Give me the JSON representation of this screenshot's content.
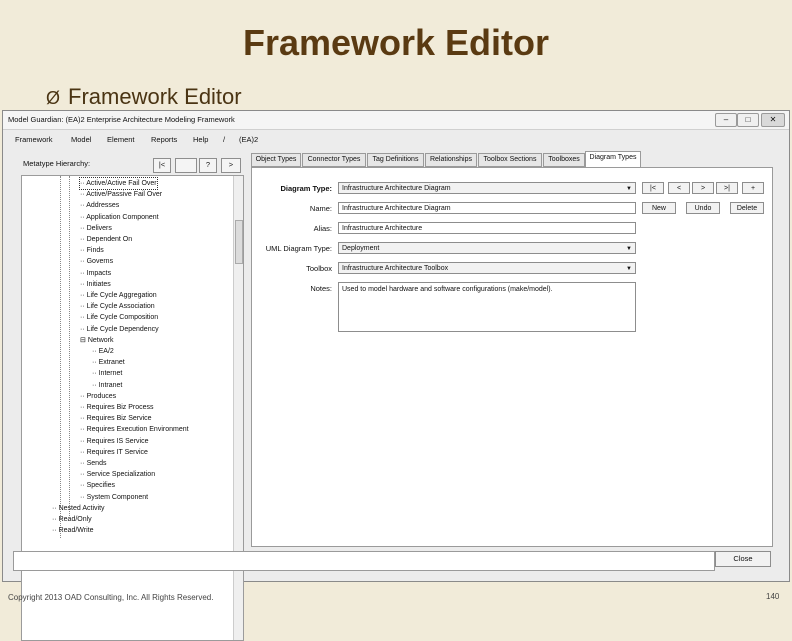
{
  "slide": {
    "title": "Framework Editor",
    "bullet": "Framework Editor",
    "bullet_glyph": "Ø",
    "footer_copyright": "Copyright 2013 OAD Consulting, Inc. All Rights Reserved.",
    "page_number": "140"
  },
  "window": {
    "title": "Model Guardian: (EA)2 Enterprise Architecture Modeling Framework",
    "minimize": "–",
    "maximize": "□",
    "close": "✕",
    "menu": [
      "Framework",
      "Model",
      "Element",
      "Reports",
      "Help",
      "/",
      "(EA)2"
    ]
  },
  "tree": {
    "label": "Metatype Hierarchy:",
    "buttons": [
      "|<",
      "",
      "?",
      ">"
    ],
    "items": [
      {
        "label": "Active/Active Fail Over",
        "indent": 1,
        "selected": true
      },
      {
        "label": "Active/Passive Fail Over",
        "indent": 1
      },
      {
        "label": "Addresses",
        "indent": 1
      },
      {
        "label": "Application Component",
        "indent": 1
      },
      {
        "label": "Delivers",
        "indent": 1
      },
      {
        "label": "Dependent On",
        "indent": 1
      },
      {
        "label": "Finds",
        "indent": 1
      },
      {
        "label": "Governs",
        "indent": 1
      },
      {
        "label": "Impacts",
        "indent": 1
      },
      {
        "label": "Initiates",
        "indent": 1
      },
      {
        "label": "Life Cycle Aggregation",
        "indent": 1
      },
      {
        "label": "Life Cycle Association",
        "indent": 1
      },
      {
        "label": "Life Cycle Composition",
        "indent": 1
      },
      {
        "label": "Life Cycle Dependency",
        "indent": 1
      },
      {
        "label": "Network",
        "indent": 1,
        "expander": "−"
      },
      {
        "label": "EA/2",
        "indent": 2
      },
      {
        "label": "Extranet",
        "indent": 2
      },
      {
        "label": "Internet",
        "indent": 2
      },
      {
        "label": "Intranet",
        "indent": 2
      },
      {
        "label": "Produces",
        "indent": 1
      },
      {
        "label": "Requires Biz Process",
        "indent": 1
      },
      {
        "label": "Requires Biz Service",
        "indent": 1
      },
      {
        "label": "Requires Execution Environment",
        "indent": 1
      },
      {
        "label": "Requires IS Service",
        "indent": 1
      },
      {
        "label": "Requires IT Service",
        "indent": 1
      },
      {
        "label": "Sends",
        "indent": 1
      },
      {
        "label": "Service Specialization",
        "indent": 1
      },
      {
        "label": "Specifies",
        "indent": 1
      },
      {
        "label": "System Component",
        "indent": 1
      },
      {
        "label": "Nested Activity",
        "indent": 0
      },
      {
        "label": "Read/Only",
        "indent": 0
      },
      {
        "label": "Read/Write",
        "indent": 0
      }
    ]
  },
  "tabs": [
    {
      "label": "Object Types"
    },
    {
      "label": "Connector Types"
    },
    {
      "label": "Tag Definitions"
    },
    {
      "label": "Relationships"
    },
    {
      "label": "Toolbox Sections"
    },
    {
      "label": "Toolboxes"
    },
    {
      "label": "Diagram Types",
      "active": true
    }
  ],
  "form": {
    "diagram_type_label": "Diagram Type:",
    "diagram_type_value": "Infrastructure Architecture Diagram",
    "name_label": "Name:",
    "name_value": "Infrastructure Architecture Diagram",
    "alias_label": "Alias:",
    "alias_value": "Infrastructure Architecture",
    "uml_label": "UML Diagram Type:",
    "uml_value": "Deployment",
    "toolbox_label": "Toolbox",
    "toolbox_value": "Infrastructure Architecture Toolbox",
    "notes_label": "Notes:",
    "notes_value": "Used to model hardware and software configurations (make/model).",
    "nav_buttons": [
      "|<",
      "<",
      ">",
      ">|",
      "+"
    ],
    "new_label": "New",
    "undo_label": "Undo",
    "delete_label": "Delete"
  },
  "footer_window": {
    "close_label": "Close"
  }
}
